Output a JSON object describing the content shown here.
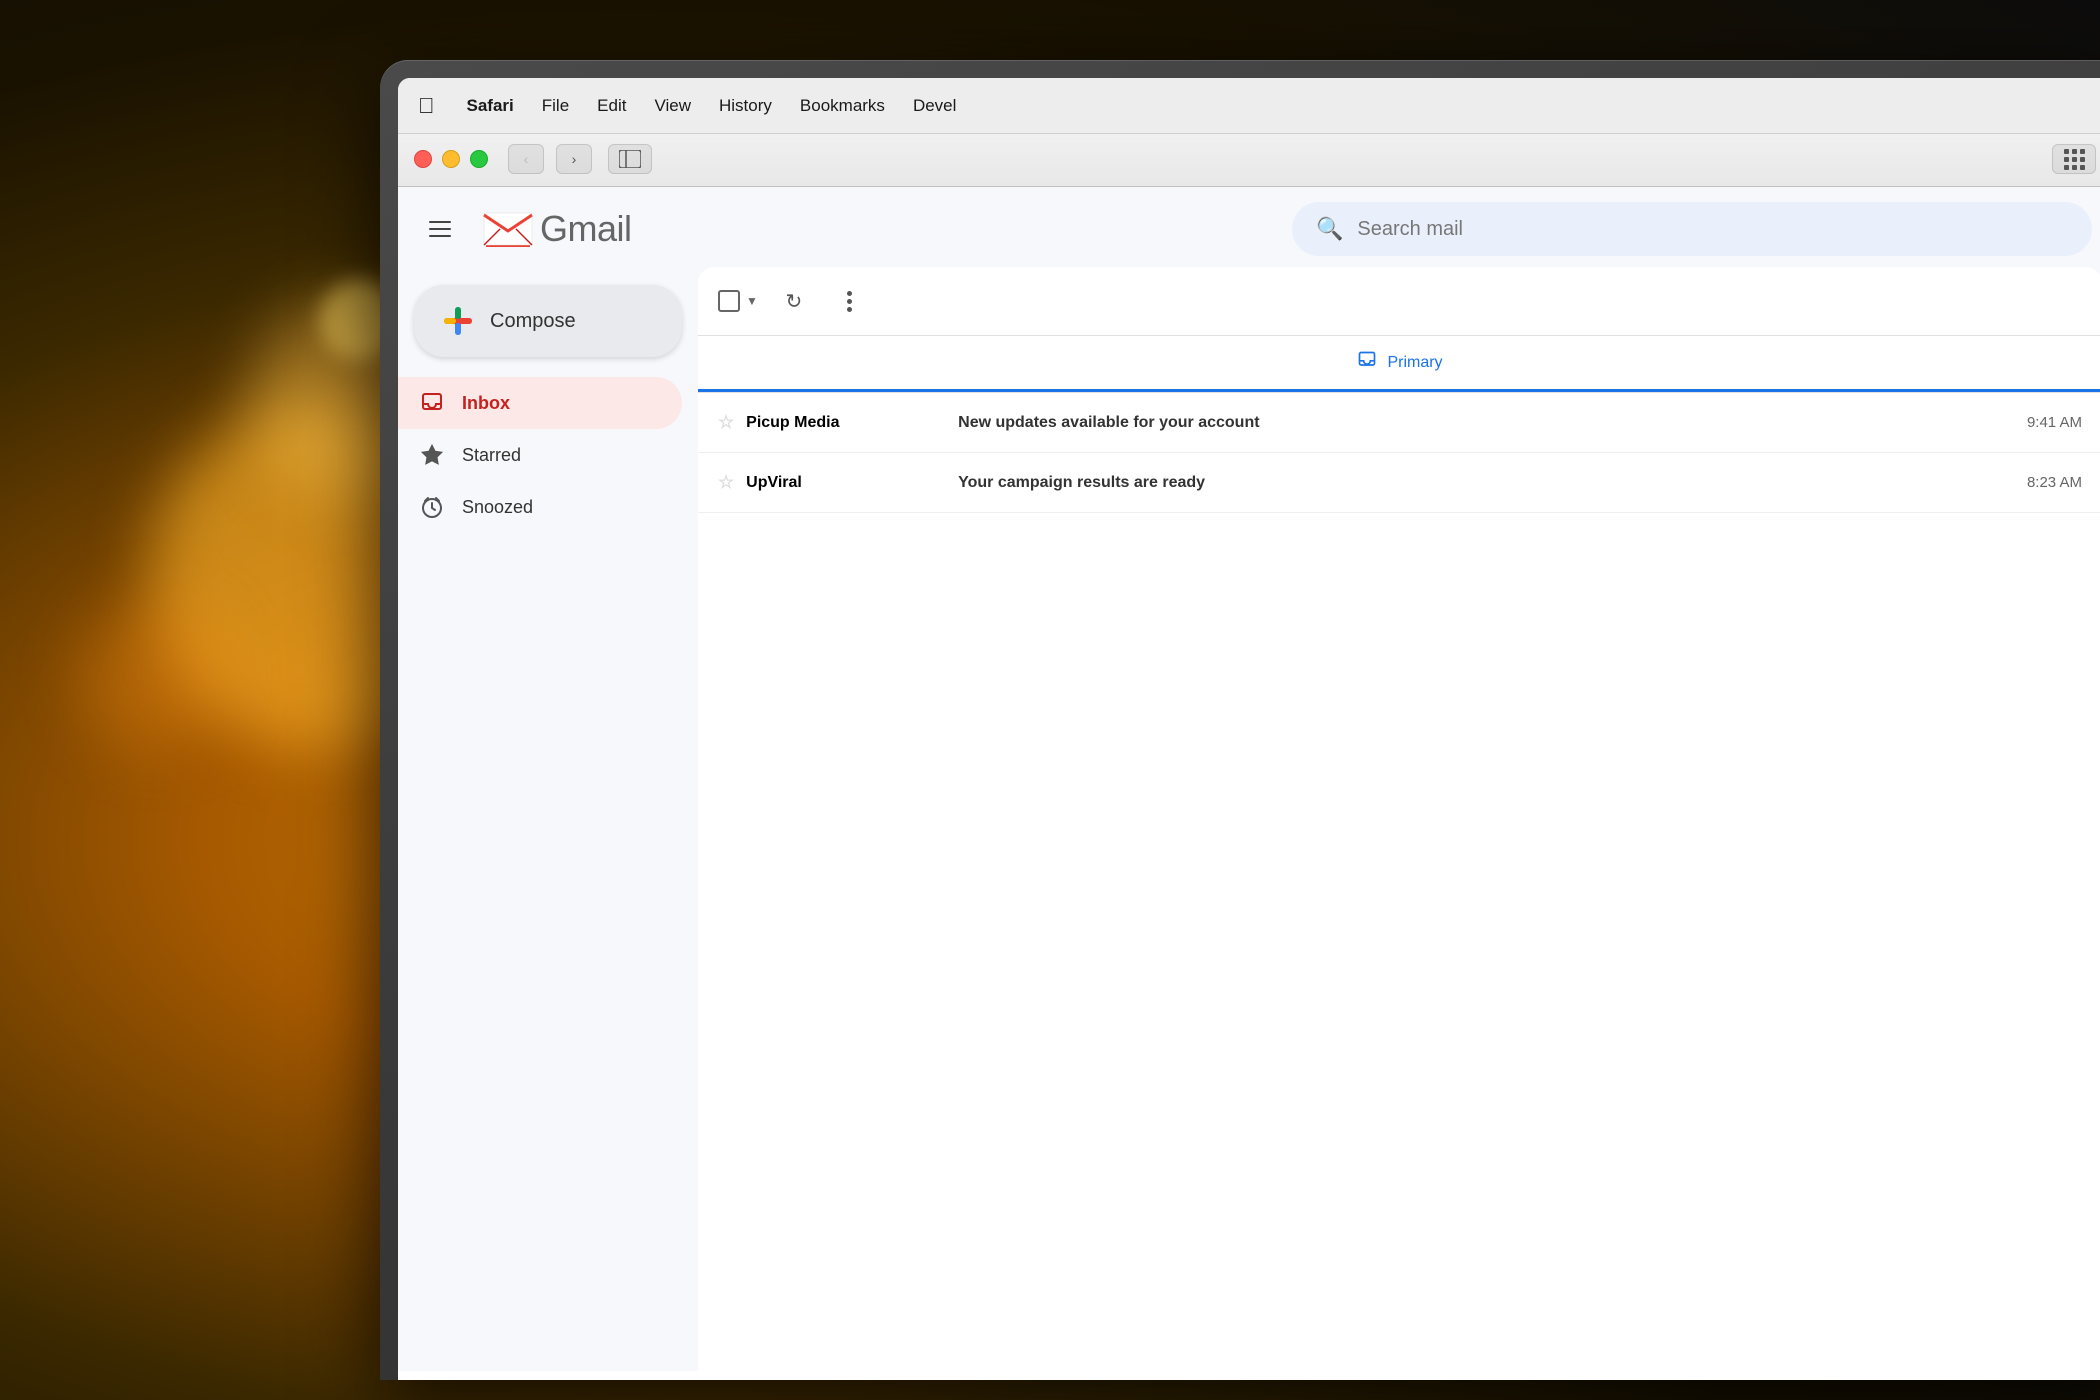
{
  "background": {
    "description": "Dark warm bokeh background with orange light blur"
  },
  "menubar": {
    "apple_symbol": "&#63743;",
    "items": [
      {
        "label": "Safari",
        "bold": true
      },
      {
        "label": "File"
      },
      {
        "label": "Edit"
      },
      {
        "label": "View"
      },
      {
        "label": "History"
      },
      {
        "label": "Bookmarks"
      },
      {
        "label": "Devel"
      }
    ]
  },
  "browser": {
    "back_btn": "‹",
    "forward_btn": "›",
    "sidebar_icon": "⊡",
    "grid_icon": "grid"
  },
  "gmail": {
    "hamburger_label": "menu",
    "logo_text": "Gmail",
    "search_placeholder": "Search mail",
    "compose_label": "Compose",
    "nav_items": [
      {
        "id": "inbox",
        "label": "Inbox",
        "icon": "inbox",
        "active": true
      },
      {
        "id": "starred",
        "label": "Starred",
        "icon": "star"
      },
      {
        "id": "snoozed",
        "label": "Snoozed",
        "icon": "clock"
      }
    ],
    "tabs": [
      {
        "id": "primary",
        "label": "Primary",
        "icon": "inbox",
        "active": true
      }
    ],
    "toolbar": {
      "checkbox_label": "select",
      "refresh_label": "refresh",
      "more_label": "more"
    },
    "emails": [
      {
        "sender": "Picup Media",
        "subject": "New updates available for your account",
        "time": "9:41 AM",
        "starred": false,
        "unread": true
      },
      {
        "sender": "UpViral",
        "subject": "Your campaign results are ready",
        "time": "8:23 AM",
        "starred": false,
        "unread": true
      }
    ]
  },
  "colors": {
    "gmail_red": "#db4437",
    "gmail_blue": "#4285f4",
    "gmail_yellow": "#f4b400",
    "gmail_green": "#0f9d58",
    "active_tab": "#1a73e8",
    "inbox_bg": "#fce8e6",
    "inbox_text": "#c5221f"
  }
}
